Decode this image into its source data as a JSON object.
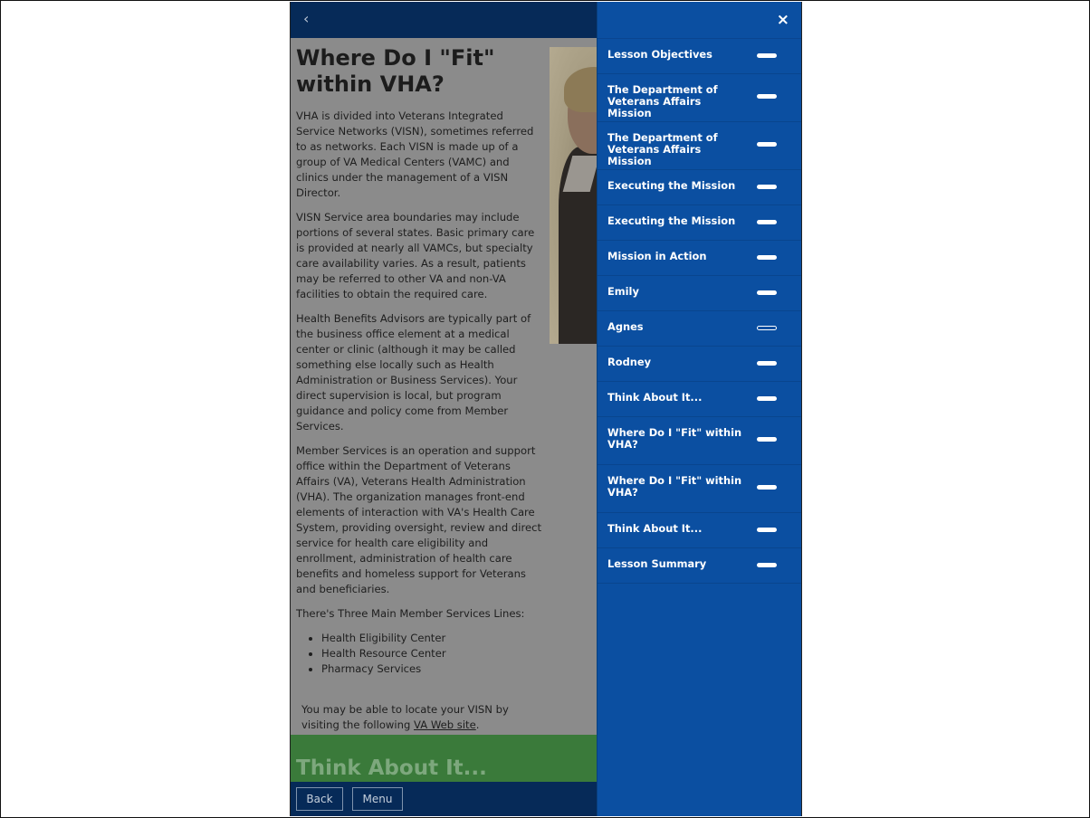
{
  "topbar": {
    "back_icon": "chevron-left-icon",
    "back_glyph": "‹"
  },
  "article": {
    "title": "Where Do I \"Fit\" within VHA?",
    "paragraphs": [
      "VHA is divided into Veterans Integrated Service Networks (VISN), sometimes referred to as networks. Each VISN is made up of a group of VA Medical Centers (VAMC) and clinics under the management of a VISN Director.",
      "VISN Service area boundaries may include portions of several states. Basic primary care is provided at nearly all VAMCs, but specialty care availability varies. As a result, patients may be referred to other VA and non-VA facilities to obtain the required care.",
      "Health Benefits Advisors are typically part of the business office element at a medical center or clinic (although it may be called something else locally such as Health Administration or Business Services). Your direct supervision is local, but program guidance and policy come from Member Services.",
      "Member Services is an operation and support office within the Department of Veterans Affairs (VA), Veterans Health Administration (VHA). The organization manages front-end elements of interaction with VA's Health Care System, providing oversight, review and direct service for health care eligibility and enrollment, administration of health care benefits and homeless support for Veterans and beneficiaries.",
      "There's Three Main Member Services Lines:"
    ],
    "service_lines": [
      "Health Eligibility Center",
      "Health Resource Center",
      "Pharmacy Services"
    ],
    "visn_note_prefix": "You may be able to locate your VISN by visiting the following ",
    "visn_link": "VA Web site",
    "visn_note_suffix": "."
  },
  "next_section": {
    "title": "Think About It..."
  },
  "bottombar": {
    "back_label": "Back",
    "menu_label": "Menu"
  },
  "menu": {
    "close_glyph": "×",
    "close_icon": "close-icon",
    "items": [
      {
        "label": "Lesson Objectives",
        "status": "complete"
      },
      {
        "label": "The Department of Veterans Affairs Mission",
        "status": "complete"
      },
      {
        "label": "The Department of Veterans Affairs Mission",
        "status": "complete"
      },
      {
        "label": "Executing the Mission",
        "status": "complete"
      },
      {
        "label": "Executing the Mission",
        "status": "complete"
      },
      {
        "label": "Mission in Action",
        "status": "complete"
      },
      {
        "label": "Emily",
        "status": "complete"
      },
      {
        "label": "Agnes",
        "status": "incomplete"
      },
      {
        "label": "Rodney",
        "status": "complete"
      },
      {
        "label": "Think About It...",
        "status": "complete"
      },
      {
        "label": "Where Do I \"Fit\" within VHA?",
        "status": "complete"
      },
      {
        "label": "Where Do I \"Fit\" within VHA?",
        "status": "complete"
      },
      {
        "label": "Think About It...",
        "status": "complete"
      },
      {
        "label": "Lesson Summary",
        "status": "complete"
      }
    ]
  },
  "colors": {
    "header_navy": "#062a58",
    "menu_blue": "#0b4fa1",
    "overlay_gray": "#8b8b8b",
    "section_green": "#3a7a3a"
  }
}
